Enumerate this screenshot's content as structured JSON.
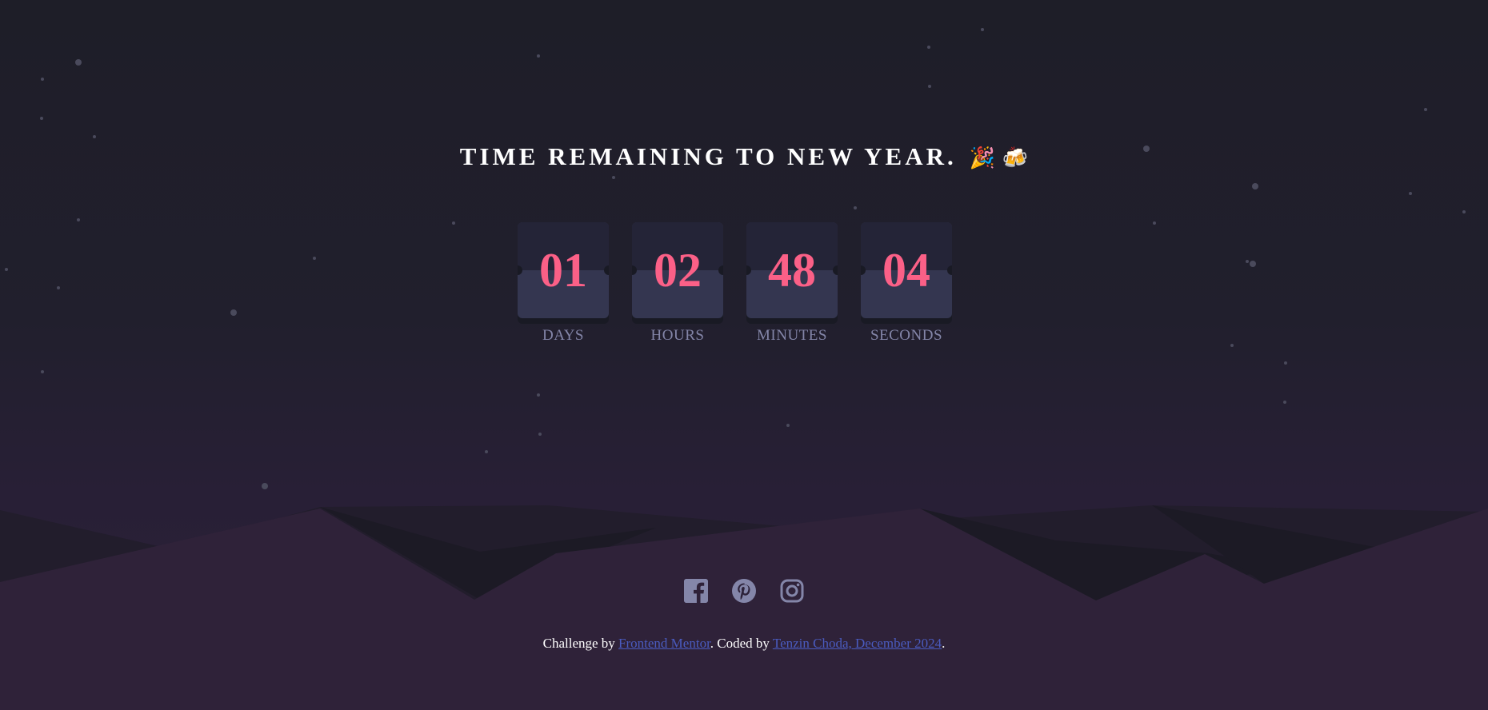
{
  "title": {
    "text": "TIME REMAINING TO NEW YEAR.",
    "emoji": "🎉 🍻"
  },
  "countdown": [
    {
      "value": "01",
      "label": "DAYS"
    },
    {
      "value": "02",
      "label": "HOURS"
    },
    {
      "value": "48",
      "label": "MINUTES"
    },
    {
      "value": "04",
      "label": "SECONDS"
    }
  ],
  "social": [
    "facebook-icon",
    "pinterest-icon",
    "instagram-icon"
  ],
  "credit": {
    "prefix": "Challenge by ",
    "link1": "Frontend Mentor",
    "middle": ". Coded by ",
    "link2": "Tenzin Choda, December 2024",
    "suffix": "."
  },
  "colors": {
    "accent": "#fb6087",
    "label": "#8486a9",
    "card": "#343650",
    "icon": "#8486a9",
    "link": "#4a5bbf"
  }
}
